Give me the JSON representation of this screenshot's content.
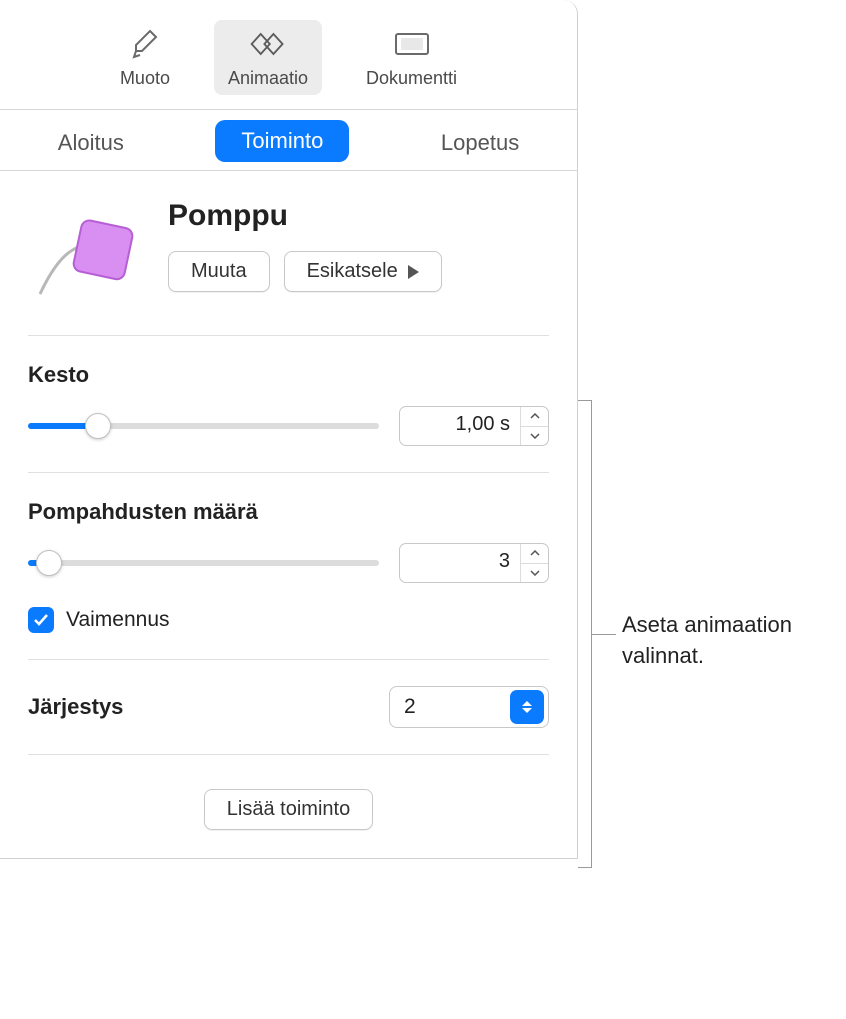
{
  "toolbar": {
    "format": "Muoto",
    "animate": "Animaatio",
    "document": "Dokumentti"
  },
  "tabs": {
    "build_in": "Aloitus",
    "action": "Toiminto",
    "build_out": "Lopetus"
  },
  "effect": {
    "name": "Pomppu",
    "change_label": "Muuta",
    "preview_label": "Esikatsele"
  },
  "duration": {
    "label": "Kesto",
    "value": "1,00 s",
    "slider_percent": 20
  },
  "bounces": {
    "label": "Pompahdusten määrä",
    "value": "3",
    "slider_percent": 6
  },
  "decay": {
    "label": "Vaimennus",
    "checked": true
  },
  "order": {
    "label": "Järjestys",
    "value": "2"
  },
  "add_action_label": "Lisää toiminto",
  "callout": "Aseta animaation valinnat."
}
